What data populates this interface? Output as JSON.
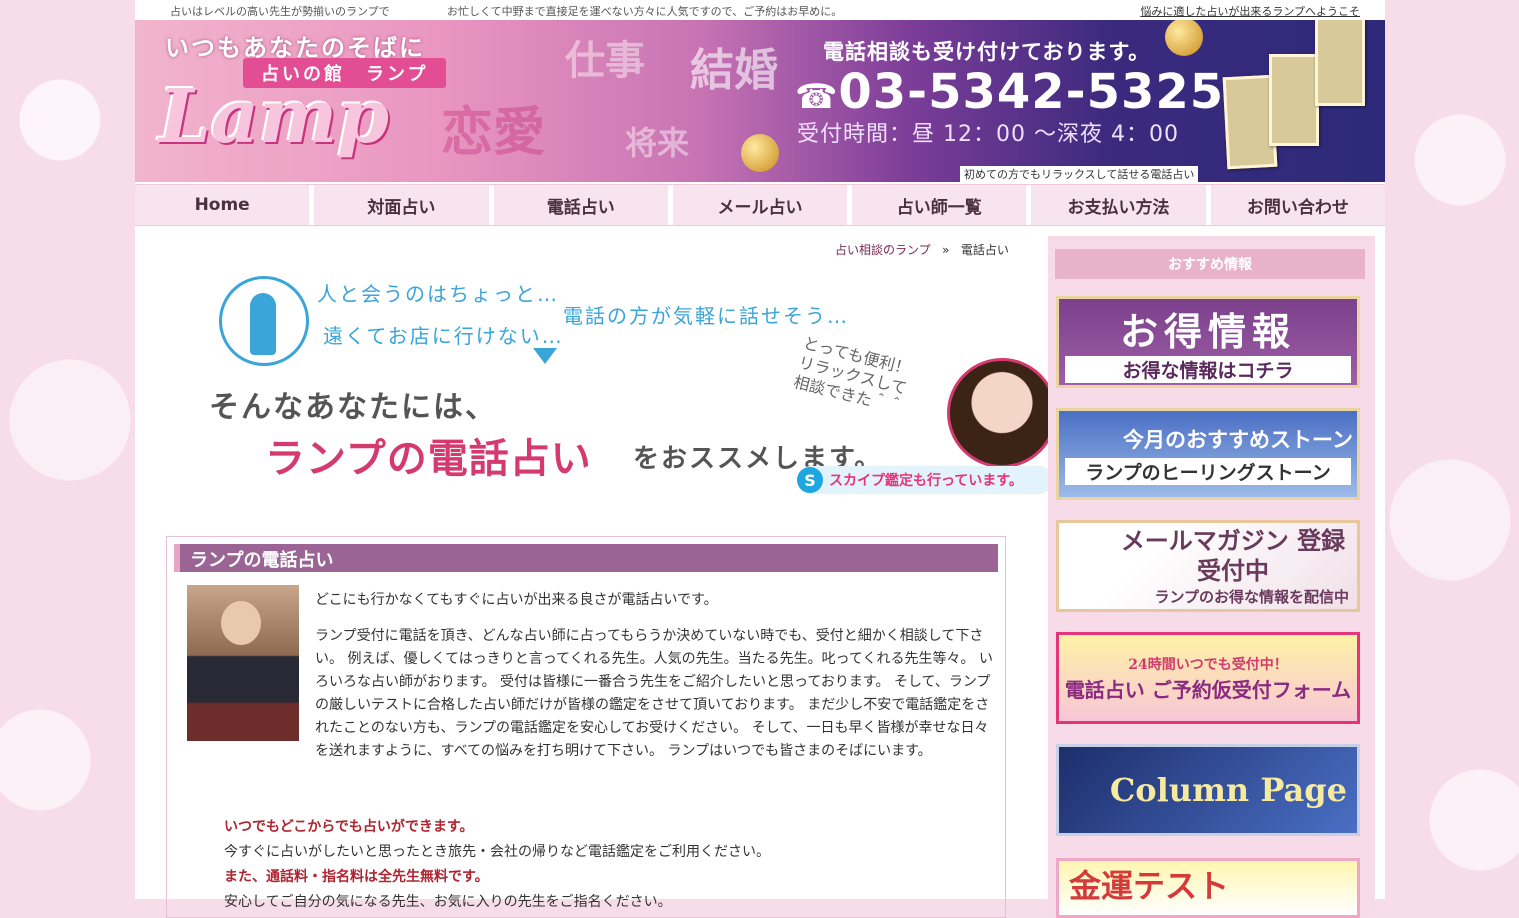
{
  "topbar": {
    "left": "占いはレベルの高い先生が勢揃いのランプで",
    "middle": "お忙しくて中野まで直接足を運べない方々に人気ですので、ご予約はお早めに。",
    "right": "悩みに適した占いが出来るランプへようこそ"
  },
  "header": {
    "subtitle": "いつもあなたのそばに",
    "badge": "占いの館　ランプ",
    "logo": "Lamp",
    "keywords": [
      "仕事",
      "結婚",
      "恋愛",
      "将来"
    ],
    "phone_lead": "電話相談も受け付けております。",
    "phone_number": "03-5342-5325",
    "hours": "受付時間：昼 12：00 ～深夜 4：00",
    "tagline": "初めての方でもリラックスして話せる電話占い"
  },
  "nav": [
    "Home",
    "対面占い",
    "電話占い",
    "メール占い",
    "占い師一覧",
    "お支払い方法",
    "お問い合わせ"
  ],
  "breadcrumb": {
    "home": "占い相談のランプ",
    "sep": "»",
    "current": "電話占い"
  },
  "banner": {
    "line1": "人と会うのはちょっと…",
    "line2": "遠くてお店に行けない…",
    "line3": "電話の方が気軽に話せそう…",
    "line4": "そんなあなたには、",
    "line5": "ランプの電話占い",
    "line6": "をおススメします。",
    "note": "とっても便利！\nリラックスして\n相談できた＾＾",
    "skype": "スカイプ鑑定も行っています。"
  },
  "article": {
    "heading": "ランプの電話占い",
    "p1": "どこにも行かなくてもすぐに占いが出来る良さが電話占いです。",
    "p2": "ランプ受付に電話を頂き、どんな占い師に占ってもらうか決めていない時でも、受付と細かく相談して下さい。 例えば、優しくてはっきりと言ってくれる先生。人気の先生。当たる先生。叱ってくれる先生等々。 いろいろな占い師がおります。 受付は皆様に一番合う先生をご紹介したいと思っております。 そして、ランプの厳しいテストに合格した占い師だけが皆様の鑑定をさせて頂いております。 まだ少し不安で電話鑑定をされたことのない方も、ランプの電話鑑定を安心してお受けください。 そして、一日も早く皆様が幸せな日々を送れますように、すべての悩みを打ち明けて下さい。 ランプはいつでも皆さまのそばにいます。",
    "h1": "いつでもどこからでも占いができます。",
    "t1": "今すぐに占いがしたいと思ったとき旅先・会社の帰りなど電話鑑定をご利用ください。",
    "h2": "また、通話料・指名料は全先生無料です。",
    "t2": "安心してご自分の気になる先生、お気に入りの先生をご指名ください。"
  },
  "sidebar": {
    "heading": "おすすめ情報",
    "banners": [
      {
        "big": "お得情報",
        "small": "お得な情報はコチラ"
      },
      {
        "big": "今月のおすすめストーン",
        "small": "ランプのヒーリングストーン"
      },
      {
        "big": "メールマガジン 登録受付中",
        "small": "ランプのお得な情報を配信中"
      },
      {
        "big": "24時間いつでも受付中！",
        "small": "電話占い ご予約仮受付フォーム"
      },
      {
        "big": "Column Page",
        "small": ""
      },
      {
        "big": "金運テスト",
        "small": ""
      }
    ]
  }
}
